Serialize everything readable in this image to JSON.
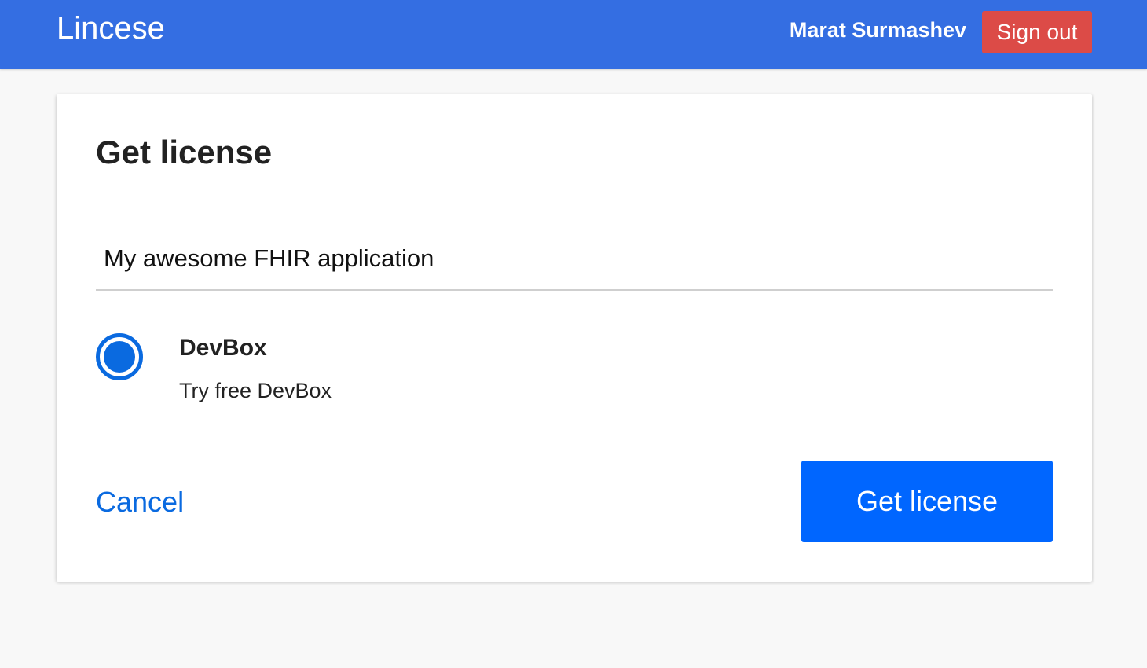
{
  "header": {
    "brand": "Lincese",
    "user_name": "Marat Surmashev",
    "sign_out_label": "Sign out",
    "background_color": "#346ee2",
    "sign_out_color": "#dc4b47"
  },
  "card": {
    "title": "Get license",
    "app_name_input": {
      "value": "My awesome FHIR application"
    },
    "plan_options": [
      {
        "name": "DevBox",
        "description": "Try free DevBox",
        "selected": true
      }
    ],
    "cancel_label": "Cancel",
    "submit_label": "Get license",
    "accent_color": "#0066ff"
  }
}
